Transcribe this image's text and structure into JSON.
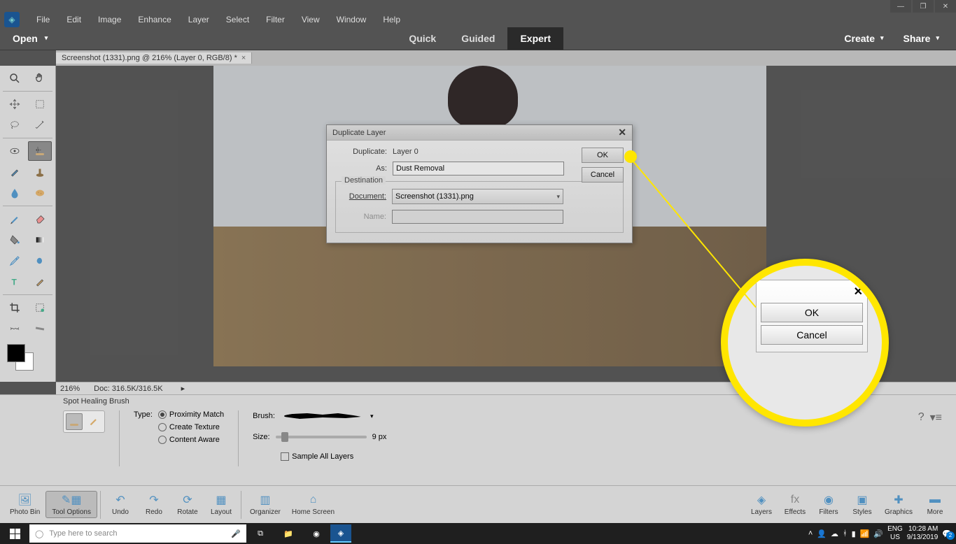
{
  "menubar": [
    "File",
    "Edit",
    "Image",
    "Enhance",
    "Layer",
    "Select",
    "Filter",
    "View",
    "Window",
    "Help"
  ],
  "secondbar": {
    "open": "Open",
    "modes": [
      "Quick",
      "Guided",
      "Expert"
    ],
    "active": "Expert",
    "create": "Create",
    "share": "Share"
  },
  "doctab": {
    "title": "Screenshot (1331).png @ 216% (Layer 0, RGB/8) *"
  },
  "dialog": {
    "title": "Duplicate Layer",
    "duplicate_label": "Duplicate:",
    "duplicate_value": "Layer 0",
    "as_label": "As:",
    "as_value": "Dust Removal",
    "dest_legend": "Destination",
    "doc_label": "Document:",
    "doc_value": "Screenshot (1331).png",
    "name_label": "Name:",
    "name_value": "",
    "ok": "OK",
    "cancel": "Cancel"
  },
  "zoom": {
    "ok": "OK",
    "cancel": "Cancel"
  },
  "status": {
    "zoom": "216%",
    "doc": "Doc: 316.5K/316.5K"
  },
  "options": {
    "title": "Spot Healing Brush",
    "type_label": "Type:",
    "radios": [
      "Proximity Match",
      "Create Texture",
      "Content Aware"
    ],
    "brush_label": "Brush:",
    "size_label": "Size:",
    "size_value": "9 px",
    "sample": "Sample All Layers"
  },
  "bottombar": {
    "left": [
      "Photo Bin",
      "Tool Options",
      "Undo",
      "Redo",
      "Rotate",
      "Layout",
      "Organizer",
      "Home Screen"
    ],
    "right": [
      "Layers",
      "Effects",
      "Filters",
      "Styles",
      "Graphics",
      "More"
    ]
  },
  "taskbar": {
    "search": "Type here to search",
    "lang1": "ENG",
    "lang2": "US",
    "time": "10:28 AM",
    "date": "9/13/2019",
    "notif": "2"
  }
}
